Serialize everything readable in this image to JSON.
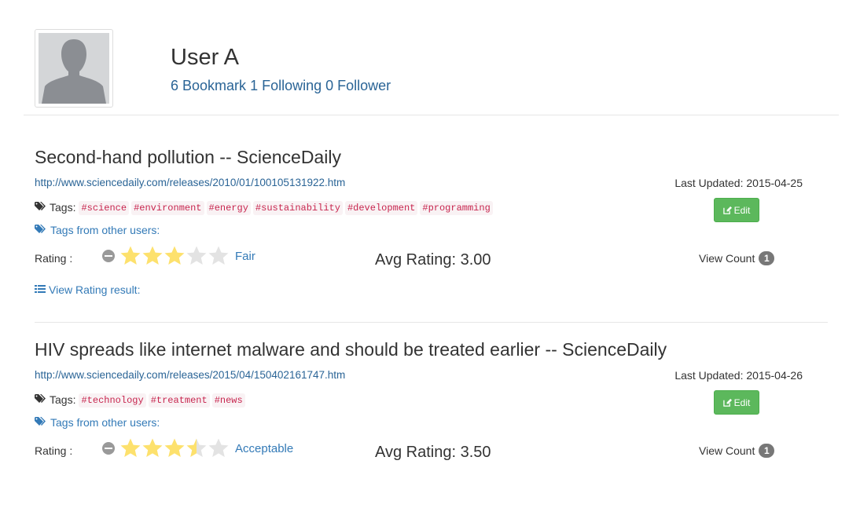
{
  "profile": {
    "name": "User A",
    "bookmark_link": "6 Bookmark",
    "following_link": "1 Following",
    "follower_link": "0 Follower"
  },
  "labels": {
    "tags": "Tags:",
    "tags_other": "Tags from other users:",
    "rating": "Rating :",
    "view_result": "View Rating result:",
    "view_count": "View Count",
    "edit": "Edit"
  },
  "bookmarks": [
    {
      "title": "Second-hand pollution -- ScienceDaily",
      "url": "http://www.sciencedaily.com/releases/2010/01/100105131922.htm",
      "last_updated": "Last Updated: 2015-04-25",
      "tags": [
        "#science",
        "#environment",
        "#energy",
        "#sustainability",
        "#development",
        "#programming"
      ],
      "rating": 3,
      "rating_caption": "Fair",
      "avg_rating": "Avg Rating: 3.00",
      "view_count": "1"
    },
    {
      "title": "HIV spreads like internet malware and should be treated earlier -- ScienceDaily",
      "url": "http://www.sciencedaily.com/releases/2015/04/150402161747.htm",
      "last_updated": "Last Updated: 2015-04-26",
      "tags": [
        "#technology",
        "#treatment",
        "#news"
      ],
      "rating": 3.5,
      "rating_caption": "Acceptable",
      "avg_rating": "Avg Rating: 3.50",
      "view_count": "1"
    }
  ],
  "colors": {
    "link": "#2a6496",
    "star_filled": "#fde16d",
    "star_empty": "#e3e3e3",
    "edit_button": "#5cb85c",
    "tag_text": "#c7254e",
    "tag_bg": "#f9f2f4"
  }
}
